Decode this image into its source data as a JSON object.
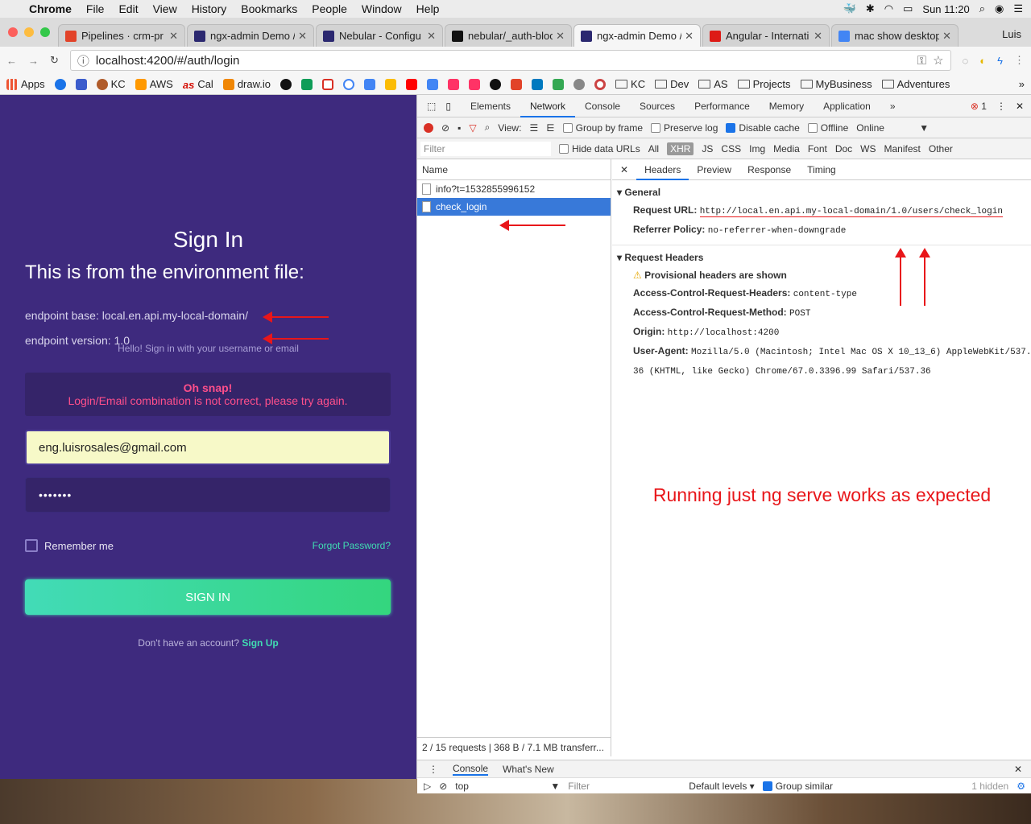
{
  "menubar": {
    "app": "Chrome",
    "items": [
      "File",
      "Edit",
      "View",
      "History",
      "Bookmarks",
      "People",
      "Window",
      "Help"
    ],
    "clock": "Sun 11:20"
  },
  "tabs": [
    {
      "title": "Pipelines · crm-pr",
      "color": "#e24329"
    },
    {
      "title": "ngx-admin Demo /",
      "color": "#2b2870"
    },
    {
      "title": "Nebular - Configu",
      "color": "#2b2870"
    },
    {
      "title": "nebular/_auth-bloc",
      "color": "#111111"
    },
    {
      "title": "ngx-admin Demo /",
      "color": "#2b2870"
    },
    {
      "title": "Angular - Internati",
      "color": "#dd1b16"
    },
    {
      "title": "mac show desktop",
      "color": "#4285f4"
    }
  ],
  "user": "Luis",
  "url": "localhost:4200/#/auth/login",
  "bookmarks": [
    "Apps",
    "KC",
    "AWS",
    "Cal",
    "draw.io",
    "KC",
    "Dev",
    "AS",
    "Projects",
    "MyBusiness",
    "Adventures"
  ],
  "page": {
    "title": "Sign In",
    "env_title": "This is from the environment file:",
    "endpoint_base": "endpoint base: local.en.api.my-local-domain/",
    "endpoint_version": "endpoint version: 1.0",
    "hello": "Hello! Sign in with your username or email",
    "alert_title": "Oh snap!",
    "alert_msg": "Login/Email combination is not correct, please try again.",
    "email": "eng.luisrosales@gmail.com",
    "password_mask": "•••••••",
    "remember": "Remember me",
    "forgot": "Forgot Password?",
    "signin_btn": "SIGN IN",
    "no_account": "Don't have an account?",
    "signup": "Sign Up"
  },
  "devtools": {
    "tabs": [
      "Elements",
      "Network",
      "Console",
      "Sources",
      "Performance",
      "Memory",
      "Application"
    ],
    "more": "»",
    "errors": "1",
    "toolbar": {
      "view": "View:",
      "group_by_frame": "Group by frame",
      "preserve_log": "Preserve log",
      "disable_cache": "Disable cache",
      "offline": "Offline",
      "online": "Online"
    },
    "filter": {
      "placeholder": "Filter",
      "hide_data_urls": "Hide data URLs",
      "types": [
        "All",
        "XHR",
        "JS",
        "CSS",
        "Img",
        "Media",
        "Font",
        "Doc",
        "WS",
        "Manifest",
        "Other"
      ]
    },
    "name_header": "Name",
    "requests": [
      "info?t=1532855996152",
      "check_login"
    ],
    "footer": "2 / 15 requests | 368 B / 7.1 MB transferr...",
    "detail_tabs": [
      "Headers",
      "Preview",
      "Response",
      "Timing"
    ],
    "general": "General",
    "request_url_label": "Request URL:",
    "request_url": "http://local.en.api.my-local-domain/1.0/users/check_login",
    "referrer_label": "Referrer Policy:",
    "referrer": "no-referrer-when-downgrade",
    "req_headers": "Request Headers",
    "provisional": "Provisional headers are shown",
    "acrh_label": "Access-Control-Request-Headers:",
    "acrh": "content-type",
    "acrm_label": "Access-Control-Request-Method:",
    "acrm": "POST",
    "origin_label": "Origin:",
    "origin": "http://localhost:4200",
    "ua_label": "User-Agent:",
    "ua": "Mozilla/5.0 (Macintosh; Intel Mac OS X 10_13_6) AppleWebKit/537.36 (KHTML, like Gecko) Chrome/67.0.3396.99 Safari/537.36",
    "annotation": "Running just ng serve works as expected",
    "drawer_tabs": [
      "Console",
      "What's New"
    ],
    "console_context": "top",
    "console_filter": "Filter",
    "levels": "Default levels ▾",
    "group_similar": "Group similar",
    "hidden": "1 hidden"
  }
}
